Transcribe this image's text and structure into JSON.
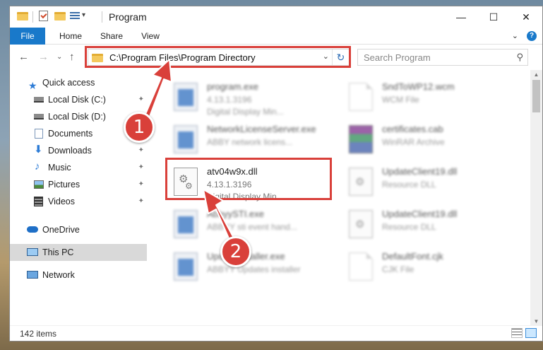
{
  "window": {
    "title": "Program",
    "controls": {
      "minimize": "—",
      "maximize": "☐",
      "close": "✕"
    }
  },
  "ribbon": {
    "tabs": [
      "File",
      "Home",
      "Share",
      "View"
    ],
    "expand": "⌄",
    "help": "?"
  },
  "nav": {
    "back": "←",
    "forward": "→",
    "recent": "⌄",
    "up": "↑",
    "address": "C:\\Program Files\\Program Directory",
    "address_dropdown": "⌄",
    "refresh": "↻",
    "search_placeholder": "Search Program"
  },
  "sidebar": {
    "items": [
      {
        "label": "Quick access",
        "icon": "star-icon",
        "pinned": false
      },
      {
        "label": "Local Disk (C:)",
        "icon": "drive-icon",
        "pinned": true
      },
      {
        "label": "Local Disk (D:)",
        "icon": "drive-icon",
        "pinned": false
      },
      {
        "label": "Documents",
        "icon": "documents-icon",
        "pinned": true
      },
      {
        "label": "Downloads",
        "icon": "download-icon",
        "pinned": true
      },
      {
        "label": "Music",
        "icon": "music-icon",
        "pinned": true
      },
      {
        "label": "Pictures",
        "icon": "pictures-icon",
        "pinned": true
      },
      {
        "label": "Videos",
        "icon": "videos-icon",
        "pinned": true
      },
      {
        "label": "OneDrive",
        "icon": "cloud-icon",
        "pinned": false
      },
      {
        "label": "This PC",
        "icon": "computer-icon",
        "pinned": false
      },
      {
        "label": "Network",
        "icon": "network-icon",
        "pinned": false
      }
    ],
    "pin_glyph": "📌"
  },
  "files": [
    {
      "name": "program.exe",
      "line1": "4.13.1.3196",
      "line2": "Digital Display Min...",
      "icon": "exe-icon",
      "blurred": true
    },
    {
      "name": "SndToWP12.wcm",
      "line1": "WCM File",
      "line2": "",
      "icon": "document-icon",
      "blurred": true
    },
    {
      "name": "NetworkLicenseServer.exe",
      "line1": "ABBY network licens...",
      "line2": "",
      "icon": "exe-icon",
      "blurred": true
    },
    {
      "name": "certificates.cab",
      "line1": "WinRAR Archive",
      "line2": "",
      "icon": "archive-icon",
      "blurred": true
    },
    {
      "name": "atv04w9x.dll",
      "line1": "4.13.1.3196",
      "line2": "Digital Display Min...",
      "icon": "dll-icon",
      "blurred": false
    },
    {
      "name": "UpdateClient19.dll",
      "line1": "Resource DLL",
      "line2": "",
      "icon": "dll-icon",
      "blurred": true
    },
    {
      "name": "AbbyySTI.exe",
      "line1": "ABBYY sti event hand...",
      "line2": "",
      "icon": "exe-icon",
      "blurred": true
    },
    {
      "name": "UpdateClient19.dll",
      "line1": "Resource DLL",
      "line2": "",
      "icon": "dll-icon",
      "blurred": true
    },
    {
      "name": "Updateinstaller.exe",
      "line1": "ABBYY Updates installer",
      "line2": "",
      "icon": "exe-icon",
      "blurred": true
    },
    {
      "name": "DefaultFont.cjk",
      "line1": "CJK File",
      "line2": "",
      "icon": "document-icon",
      "blurred": true
    }
  ],
  "status": {
    "count": "142 items"
  },
  "callouts": [
    "1",
    "2"
  ],
  "colors": {
    "accent": "#1979ca",
    "highlight": "#d9403a",
    "selection": "#cce8ff"
  }
}
